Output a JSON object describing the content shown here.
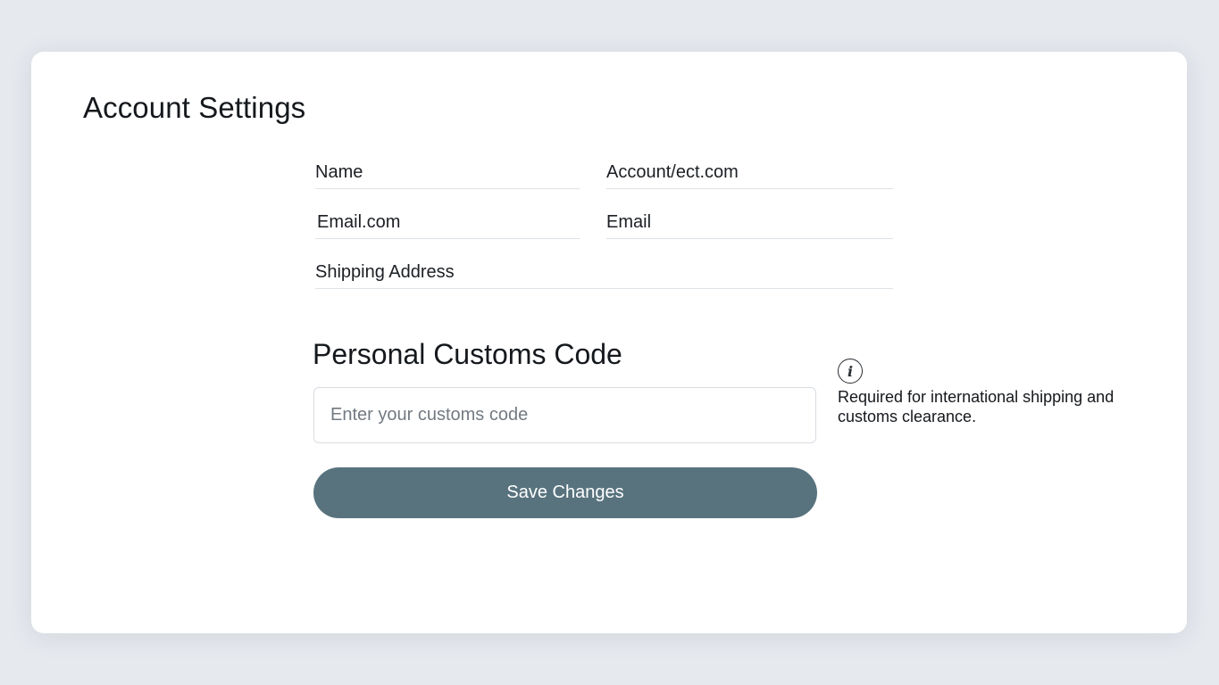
{
  "page": {
    "title": "Account Settings"
  },
  "fields": {
    "name_label": "Name",
    "account_value": "Account/ect.com",
    "email_value": "Email.com",
    "email_label": "Email",
    "shipping_label": "Shipping Address"
  },
  "customs": {
    "title": "Personal Customs Code",
    "placeholder": "Enter your customs code",
    "info_icon": "info-icon",
    "info_text": "Required for international shipping and customs clearance."
  },
  "actions": {
    "save_label": "Save Changes"
  },
  "colors": {
    "background": "#e6e9ee",
    "card": "#ffffff",
    "button": "#58737e",
    "divider": "#dde3e8"
  }
}
